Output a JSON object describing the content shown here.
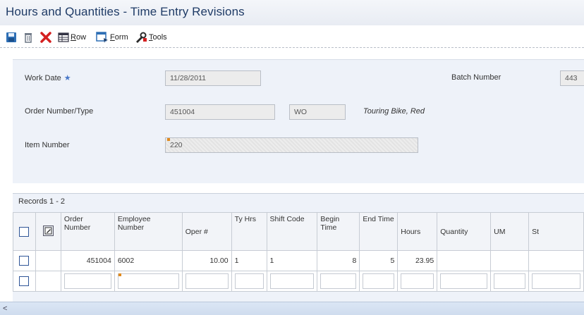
{
  "window": {
    "title": "Hours and Quantities - Time Entry Revisions"
  },
  "toolbar": {
    "save_icon": "save-icon",
    "delete_icon": "trash-icon",
    "cancel_icon": "close-icon",
    "row_label_first": "R",
    "row_label_rest": "ow",
    "form_label_first": "F",
    "form_label_rest": "orm",
    "tools_label_first": "T",
    "tools_label_rest": "ools"
  },
  "form": {
    "work_date_label": "Work Date",
    "work_date_value": "11/28/2011",
    "batch_number_label": "Batch Number",
    "batch_number_value": "443",
    "order_label": "Order Number/Type",
    "order_number_value": "451004",
    "order_type_value": "WO",
    "order_description": "Touring Bike, Red",
    "item_number_label": "Item Number",
    "item_number_value": "220"
  },
  "grid": {
    "records_label": "Records 1 - 2",
    "columns": [
      "Order Number",
      "Employee Number",
      "Oper #",
      "Ty Hrs",
      "Shift Code",
      "Begin Time",
      "End Time",
      "Hours",
      "Quantity",
      "UM",
      "St"
    ],
    "rows": [
      {
        "order_number": "451004",
        "employee_number": "6002",
        "oper": "10.00",
        "ty_hrs": "1",
        "shift_code": "1",
        "begin_time": "8",
        "end_time": "5",
        "hours": "23.95",
        "quantity": "",
        "um": "",
        "st": ""
      }
    ]
  },
  "colors": {
    "title": "#1f3b66",
    "accent": "#2f5597",
    "required": "#e08a1e",
    "form_bg": "#eef2f9"
  }
}
